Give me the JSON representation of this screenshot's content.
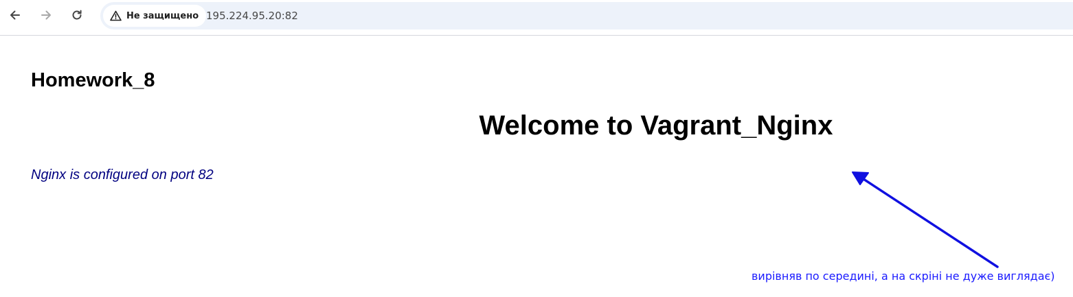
{
  "browser": {
    "security_label": "Не защищено",
    "url": "195.224.95.20:82",
    "icons": {
      "back": "arrow-left-icon",
      "forward": "arrow-right-icon",
      "reload": "reload-icon",
      "warning": "warning-triangle-icon"
    }
  },
  "page": {
    "homework_title": "Homework_8",
    "welcome_heading": "Welcome to Vagrant_Nginx",
    "port_note": "Nginx is configured on port 82",
    "port_note_color": "#000080"
  },
  "annotation": {
    "text": "вирівняв по середині, а на скріні не дуже виглядає)",
    "color": "#1a1aff"
  }
}
